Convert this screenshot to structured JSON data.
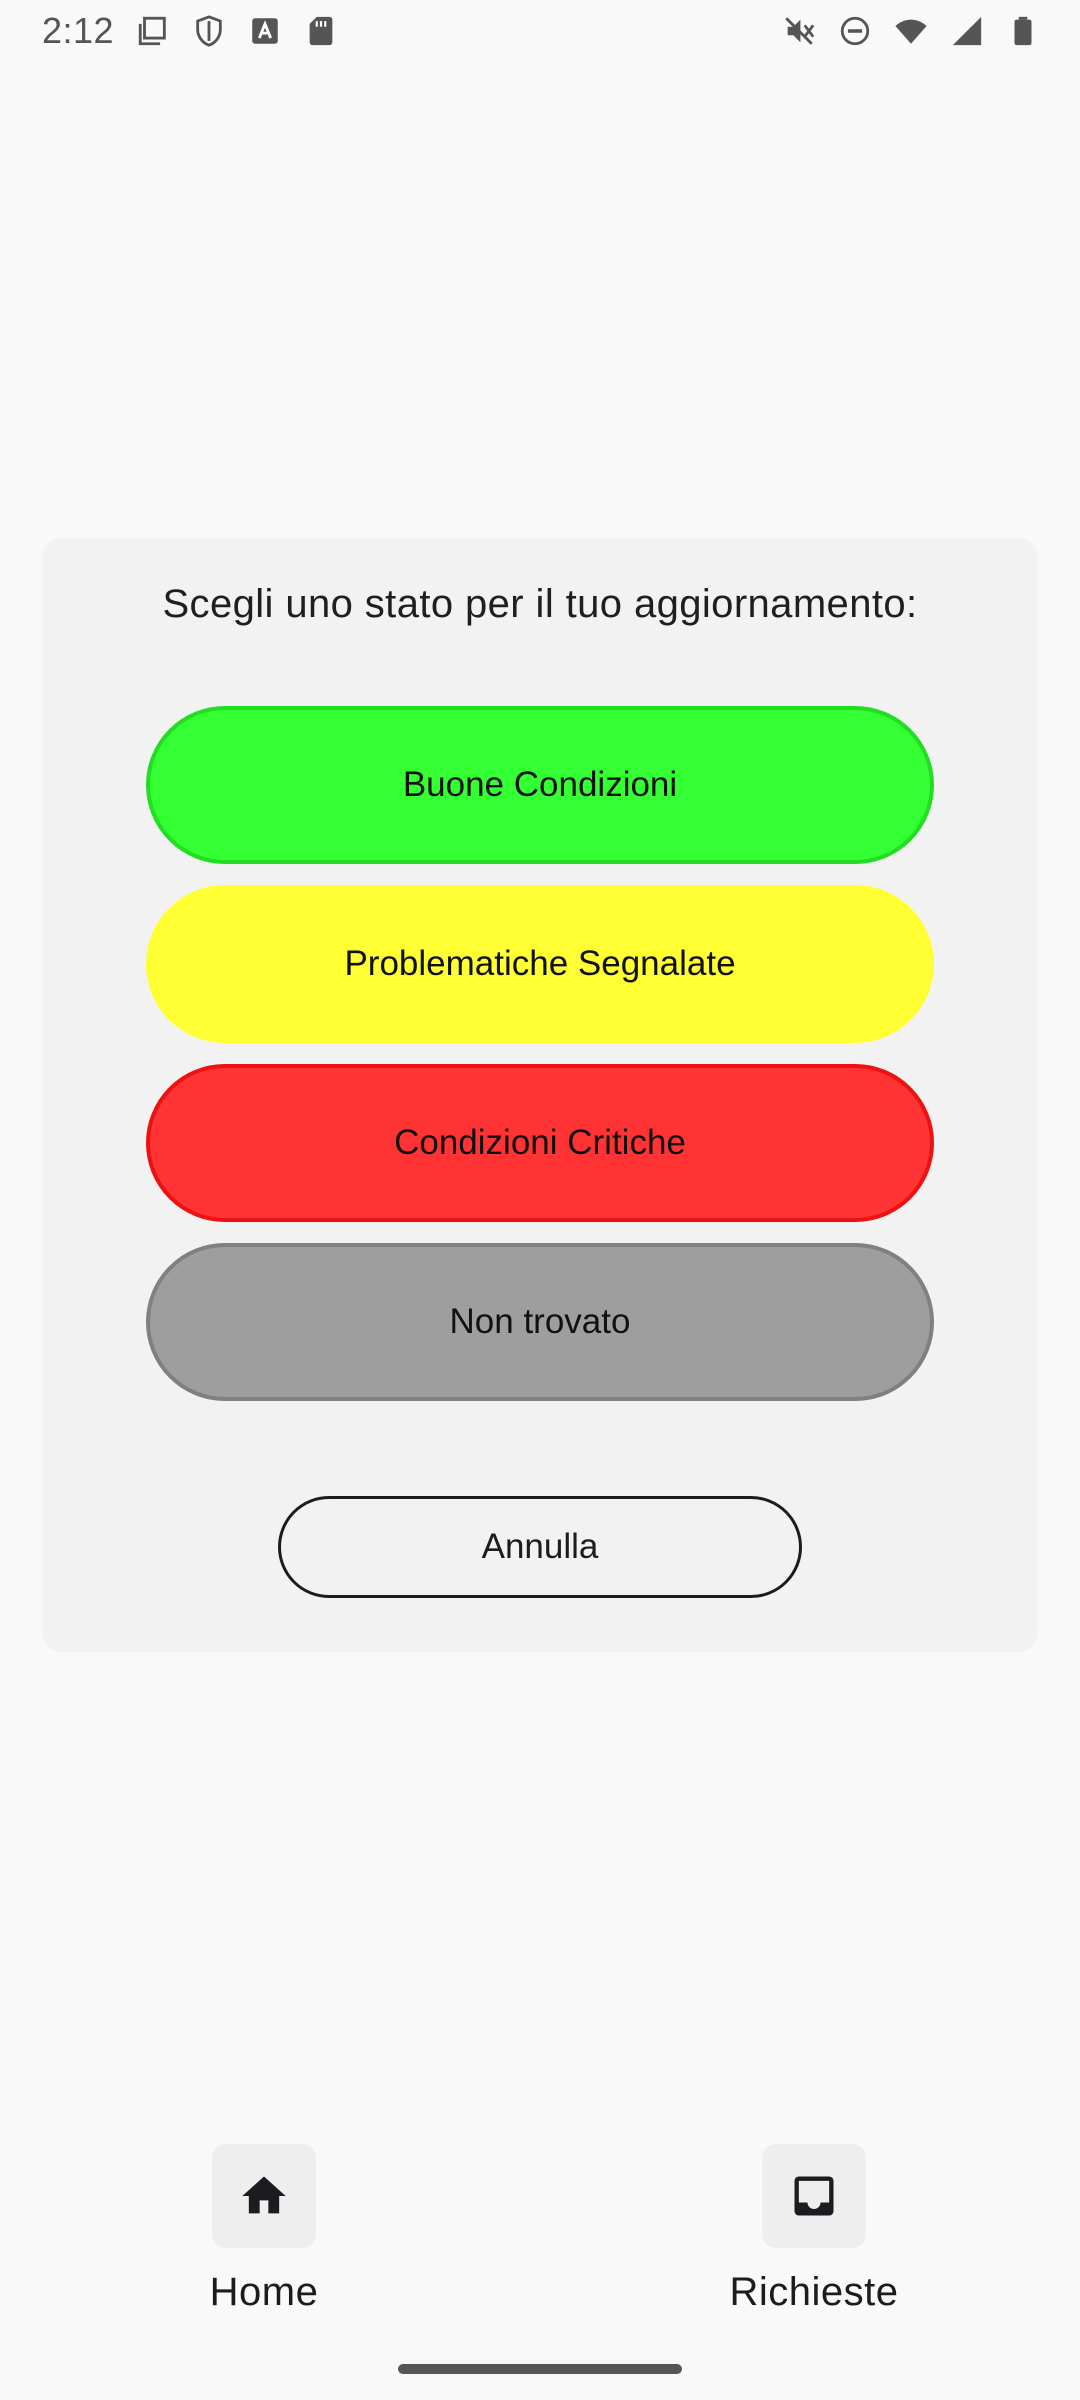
{
  "status_bar": {
    "time": "2:12",
    "left_icons": [
      "screenshot-icon",
      "shield-icon",
      "text-a-icon",
      "sd-card-icon"
    ],
    "right_icons": [
      "mute-icon",
      "dnd-icon",
      "wifi-icon",
      "signal-icon",
      "battery-icon"
    ]
  },
  "dialog": {
    "title": "Scegli uno stato per il tuo aggiornamento:",
    "options": [
      {
        "label": "Buone Condizioni",
        "fill": "#33ff33",
        "border": "#22dd22"
      },
      {
        "label": "Problematiche Segnalate",
        "fill": "#ffff33",
        "border": "#ffff33"
      },
      {
        "label": "Condizioni Critiche",
        "fill": "#ff3333",
        "border": "#ee1111"
      },
      {
        "label": "Non trovato",
        "fill": "#9e9e9e",
        "border": "#808080"
      }
    ],
    "cancel_label": "Annulla"
  },
  "bottom_nav": {
    "items": [
      {
        "label": "Home",
        "icon": "home-icon"
      },
      {
        "label": "Richieste",
        "icon": "inbox-icon"
      }
    ]
  }
}
